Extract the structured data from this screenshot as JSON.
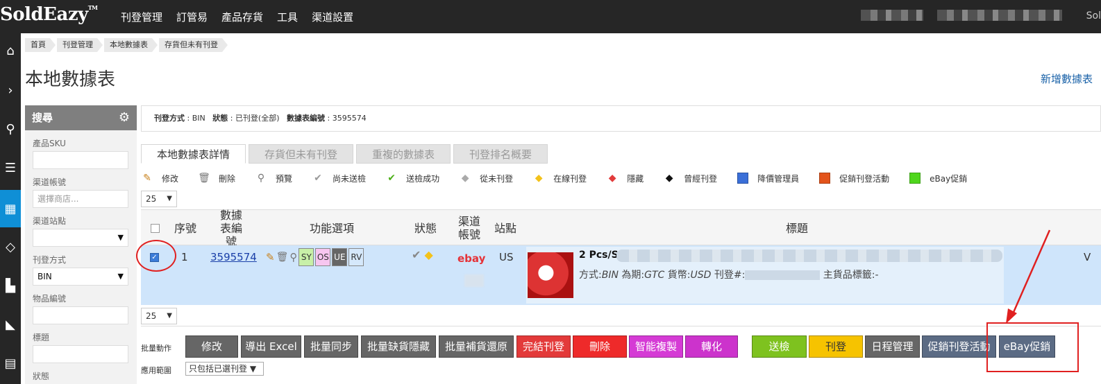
{
  "app": {
    "logo": "SoldEazy",
    "tm": "TM"
  },
  "nav": [
    "刊登管理",
    "訂管易",
    "產品存貨",
    "工具",
    "渠道設置"
  ],
  "topbar_user": "Sol",
  "breadcrumbs": [
    "首頁",
    "刊登管理",
    "本地數據表",
    "存貨但未有刊登"
  ],
  "page": {
    "title": "本地數據表",
    "new_link": "新增數據表"
  },
  "search": {
    "header": "搜尋",
    "fields": [
      {
        "label": "產品SKU",
        "value": ""
      },
      {
        "label": "渠道帳號",
        "value": "選擇商店..."
      },
      {
        "label": "渠道站點",
        "value": ""
      },
      {
        "label": "刊登方式",
        "value": "BIN"
      },
      {
        "label": "物品編號",
        "value": ""
      },
      {
        "label": "標題",
        "value": ""
      },
      {
        "label": "狀態",
        "value": ""
      }
    ]
  },
  "info": {
    "method_label": "刊登方式",
    "method_value": "BIN",
    "status_label": "狀態",
    "status_value": "已刊登(全部)",
    "sheet_label": "數據表編號",
    "sheet_value": "3595574"
  },
  "tabs": [
    "本地數據表詳情",
    "存貨但未有刊登",
    "重複的數據表",
    "刊登排名概要"
  ],
  "legend": [
    {
      "icon": "pencil-icon",
      "label": "修改"
    },
    {
      "icon": "trash-icon",
      "label": "刪除"
    },
    {
      "icon": "magnifier-icon",
      "label": "預覽"
    },
    {
      "icon": "grey-check-icon",
      "label": "尚未送檢"
    },
    {
      "icon": "green-check-icon",
      "label": "送檢成功"
    },
    {
      "icon": "grey-tag-icon",
      "label": "從未刊登"
    },
    {
      "icon": "yellow-tag-icon",
      "label": "在線刊登"
    },
    {
      "icon": "red-tag-icon",
      "label": "隱藏"
    },
    {
      "icon": "black-tag-icon",
      "label": "曾經刊登"
    },
    {
      "icon": "blue-square-icon",
      "label": "降價管理員",
      "color": "#3a6fd8"
    },
    {
      "icon": "orange-square-icon",
      "label": "促銷刊登活動",
      "color": "#e3541b"
    },
    {
      "icon": "green-square-icon",
      "label": "eBay促銷",
      "color": "#4fd61d"
    }
  ],
  "per_page": "25",
  "table": {
    "headers": {
      "seq": "序號",
      "sheet_no": "數據表編號",
      "functions": "功能選項",
      "status": "狀態",
      "account": "渠道帳號",
      "site": "站點",
      "title": "標題"
    },
    "rows": [
      {
        "seq": "1",
        "sheet_no": "3595574",
        "flags": [
          "SY",
          "OS",
          "UE",
          "RV"
        ],
        "account": "ebay",
        "site": "US",
        "title": "2 Pcs/S",
        "meta_method_label": "方式:",
        "meta_method": "BIN",
        "meta_period_label": "為期:",
        "meta_period": "GTC",
        "meta_currency_label": "貨幣:",
        "meta_currency": "USD",
        "meta_listing_label": "刊登#:",
        "meta_tag": "主貨品標籤:-",
        "edge_letter": "V"
      }
    ]
  },
  "batch": {
    "label": "批量動作",
    "scope_label": "應用範圍",
    "scope_value": "只包括已選刊登",
    "buttons": [
      {
        "label": "修改",
        "color": "#666666"
      },
      {
        "label": "導出 Excel",
        "color": "#666666"
      },
      {
        "label": "批量同步",
        "color": "#666666"
      },
      {
        "label": "批量缺貨隱藏",
        "color": "#666666"
      },
      {
        "label": "批量補貨還原",
        "color": "#666666"
      },
      {
        "label": "完結刊登",
        "color": "#e33a3a"
      },
      {
        "label": "刪除",
        "color": "#ee2a2a"
      },
      {
        "label": "智能複製",
        "color": "#d53bd5"
      },
      {
        "label": "轉化",
        "color": "#cc33cc"
      },
      {
        "label": "送檢",
        "color": "#7ec21f"
      },
      {
        "label": "刊登",
        "color": "#f6c300"
      },
      {
        "label": "日程管理",
        "color": "#666666"
      },
      {
        "label": "促銷刊登活動",
        "color": "#5b6b84"
      },
      {
        "label": "eBay促銷",
        "color": "#5b6b84"
      }
    ]
  },
  "colors": {
    "accent": "#0f8fd6",
    "row_selected": "#cfe5fb",
    "annotation": "#e02020"
  }
}
